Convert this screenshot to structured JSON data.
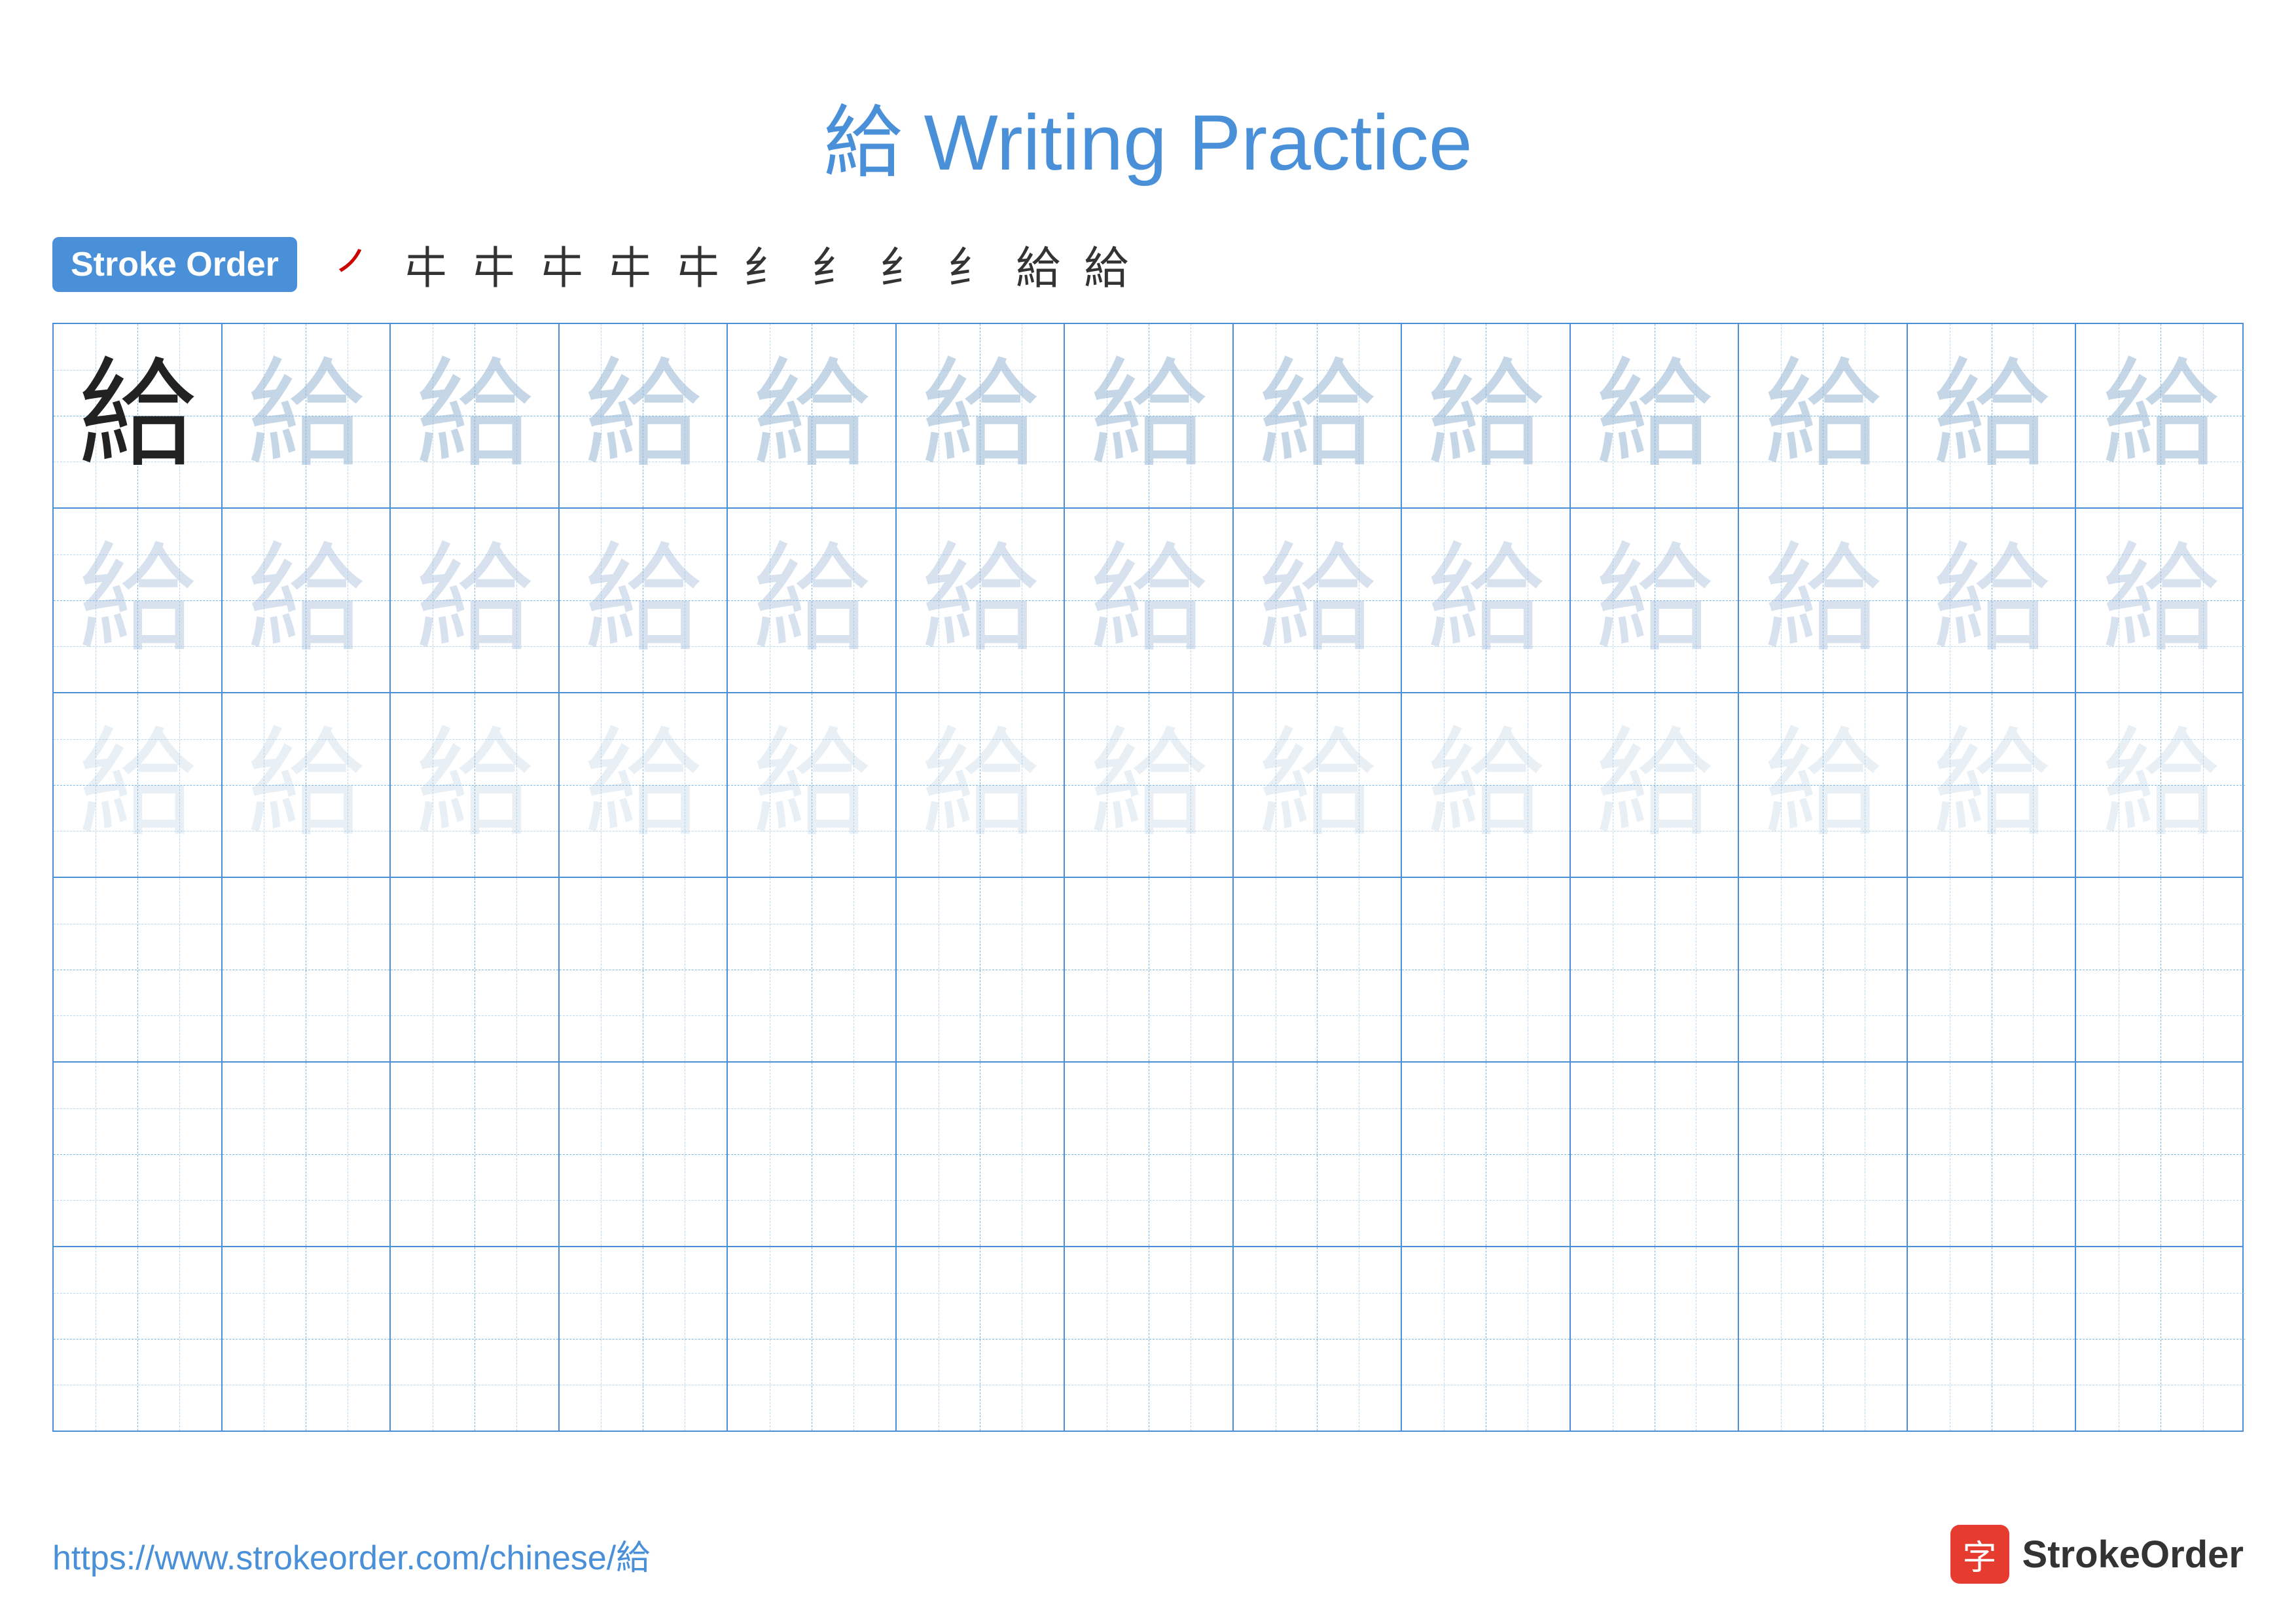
{
  "title": {
    "char": "給",
    "text": " Writing Practice"
  },
  "stroke_order": {
    "badge_label": "Stroke Order",
    "steps": [
      "㇒",
      "㐄",
      "㐄",
      "㐄",
      "㐄",
      "㐄",
      "㐄",
      "紣",
      "紣",
      "紣",
      "給",
      "給"
    ]
  },
  "grid": {
    "rows": 6,
    "cols": 13,
    "char": "給"
  },
  "footer": {
    "url": "https://www.strokeorder.com/chinese/給",
    "brand_icon": "字",
    "brand_name": "StrokeOrder"
  }
}
